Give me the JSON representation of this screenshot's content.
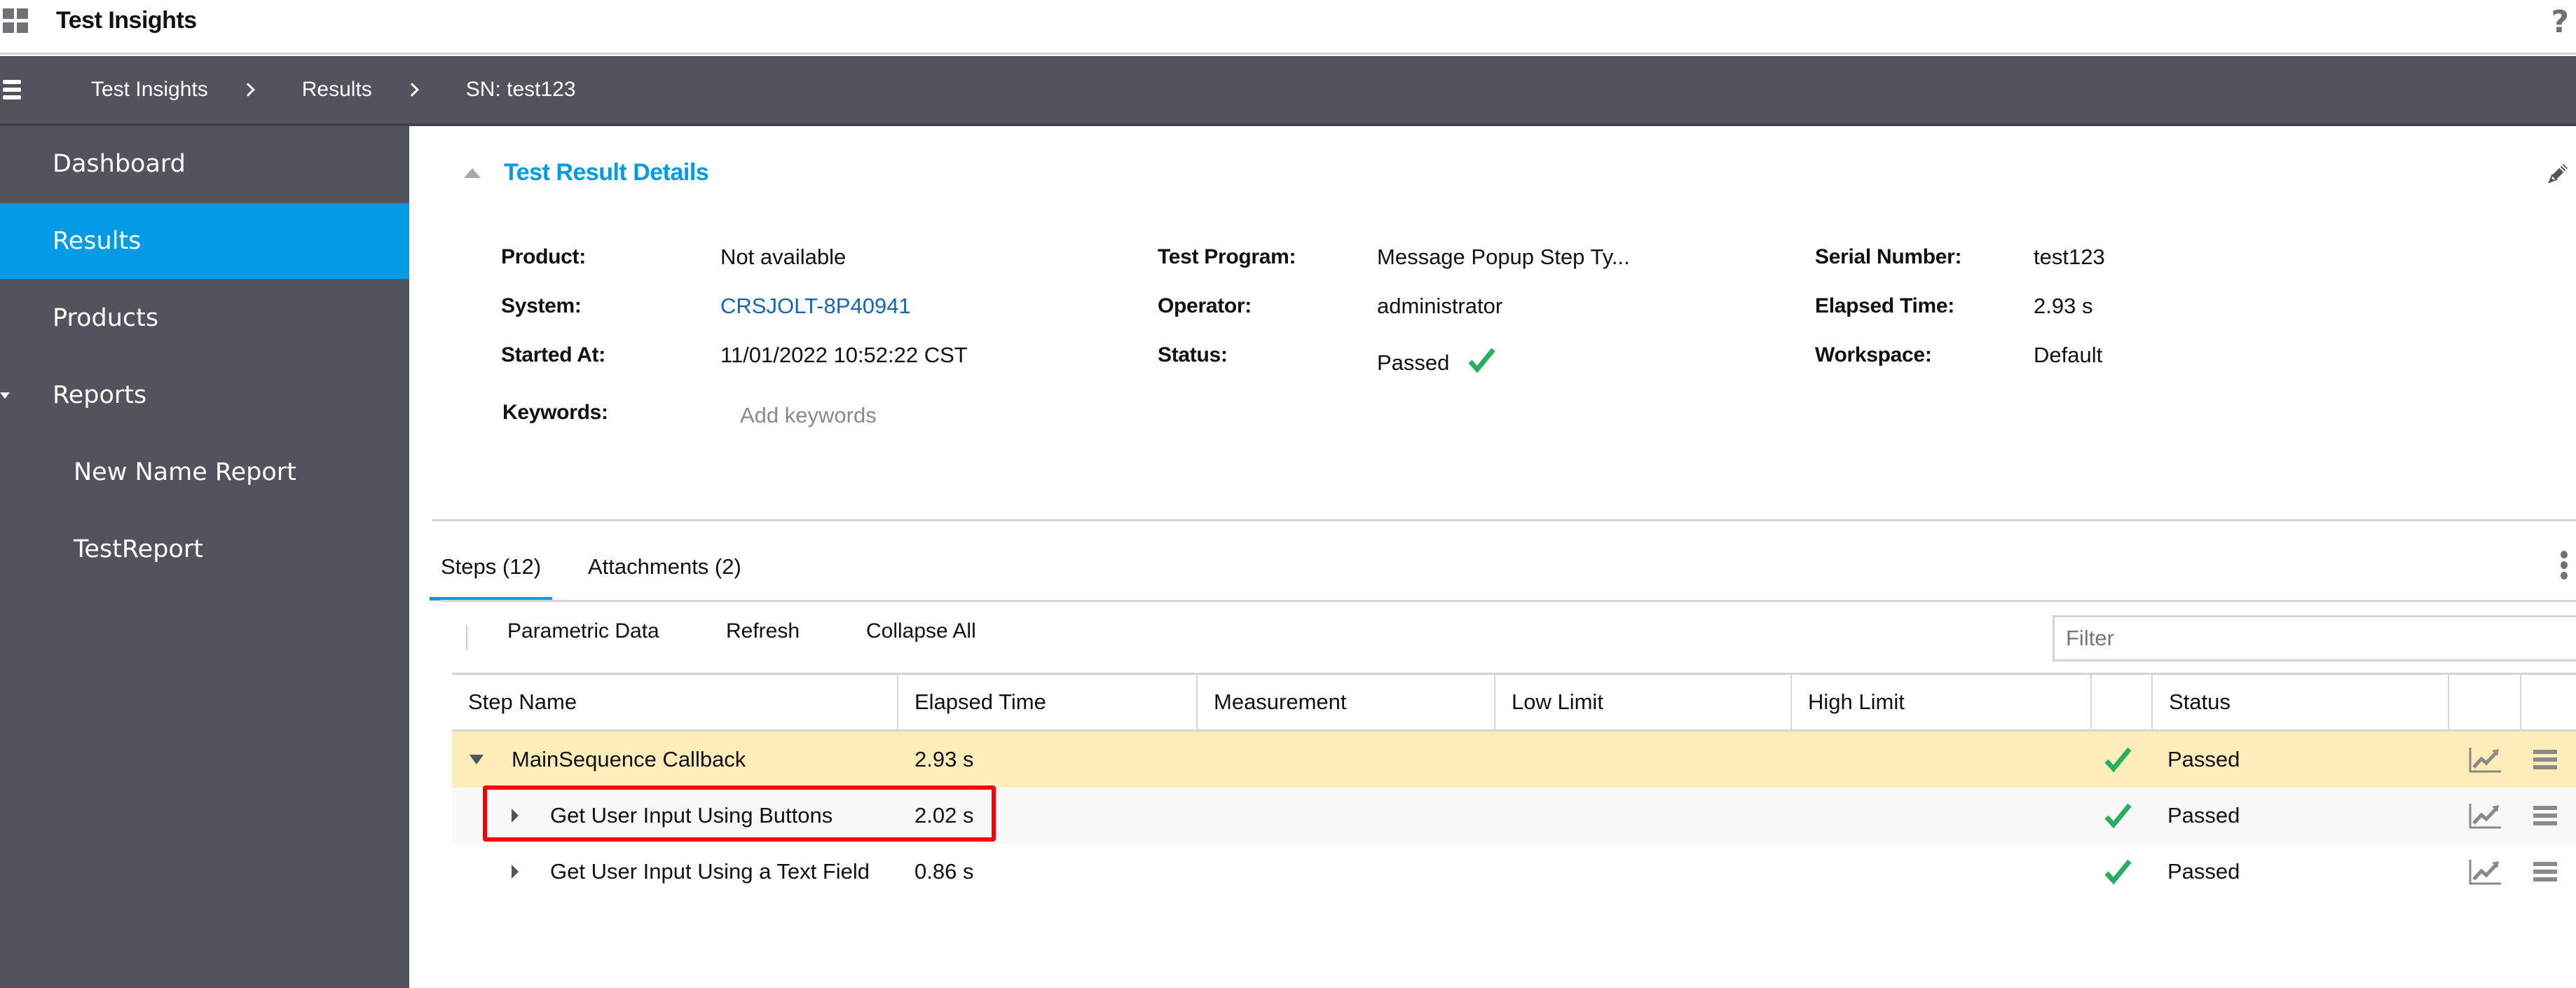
{
  "app": {
    "title": "Test Insights",
    "help_icon": "help-icon",
    "apps_icon": "apps-grid-icon"
  },
  "breadcrumb": [
    {
      "label": "Test Insights"
    },
    {
      "label": "Results"
    },
    {
      "label": "SN: test123"
    }
  ],
  "sidebar": {
    "items": [
      {
        "label": "Dashboard",
        "active": false
      },
      {
        "label": "Results",
        "active": true
      },
      {
        "label": "Products",
        "active": false
      },
      {
        "label": "Reports",
        "active": false,
        "expanded": true
      },
      {
        "label": "New Name Report",
        "active": false,
        "sub": true
      },
      {
        "label": "TestReport",
        "active": false,
        "sub": true
      }
    ]
  },
  "details": {
    "title": "Test Result Details",
    "fields": {
      "product": {
        "label": "Product:",
        "value": "Not available"
      },
      "system": {
        "label": "System:",
        "value": "CRSJOLT-8P40941"
      },
      "started_at": {
        "label": "Started At:",
        "value": "11/01/2022 10:52:22 CST"
      },
      "test_program": {
        "label": "Test Program:",
        "value": "Message Popup Step Ty..."
      },
      "operator": {
        "label": "Operator:",
        "value": "administrator"
      },
      "status": {
        "label": "Status:",
        "value": "Passed"
      },
      "serial_number": {
        "label": "Serial Number:",
        "value": "test123"
      },
      "elapsed_time": {
        "label": "Elapsed Time:",
        "value": "2.93 s"
      },
      "workspace": {
        "label": "Workspace:",
        "value": "Default"
      }
    },
    "keywords": {
      "label": "Keywords:",
      "placeholder": "Add keywords",
      "value": ""
    }
  },
  "tabs": [
    {
      "label": "Steps (12)",
      "active": true
    },
    {
      "label": "Attachments (2)",
      "active": false
    }
  ],
  "toolbar": {
    "parametric_data": "Parametric Data",
    "refresh": "Refresh",
    "collapse_all": "Collapse All",
    "filter_placeholder": "Filter",
    "filter_value": ""
  },
  "table": {
    "columns": [
      "Step Name",
      "Elapsed Time",
      "Measurement",
      "Low Limit",
      "High Limit",
      "",
      "Status",
      "",
      ""
    ],
    "rows": [
      {
        "name": "MainSequence Callback",
        "elapsed": "2.93 s",
        "measurement": "",
        "low_limit": "",
        "high_limit": "",
        "status": "Passed",
        "expanded": true,
        "level": 0,
        "selected": true
      },
      {
        "name": "Get User Input Using Buttons",
        "elapsed": "2.02 s",
        "measurement": "",
        "low_limit": "",
        "high_limit": "",
        "status": "Passed",
        "expanded": false,
        "level": 1,
        "highlighted": true
      },
      {
        "name": "Get User Input Using a Text Field",
        "elapsed": "0.86 s",
        "measurement": "",
        "low_limit": "",
        "high_limit": "",
        "status": "Passed",
        "expanded": false,
        "level": 1
      }
    ]
  },
  "colors": {
    "accent": "#039be5",
    "nav_bg": "#50545c",
    "selected_row": "#feedb8",
    "pass_green": "#27ae60",
    "link": "#1665b5",
    "highlight_box": "#ff0000"
  }
}
